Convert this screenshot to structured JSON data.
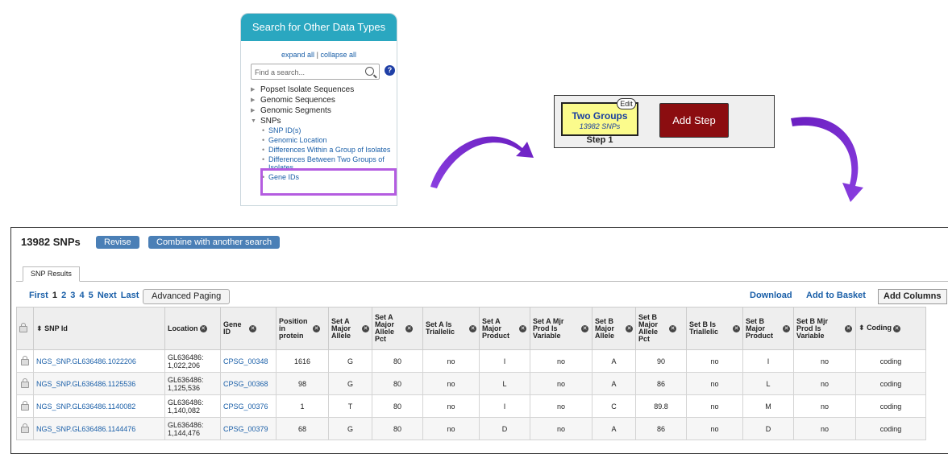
{
  "search_panel": {
    "title": "Search for Other Data Types",
    "expand_all": "expand all",
    "separator": "|",
    "collapse_all": "collapse all",
    "search_placeholder": "Find a search...",
    "tree": [
      {
        "label": "Popset Isolate Sequences"
      },
      {
        "label": "Genomic Sequences"
      },
      {
        "label": "Genomic Segments"
      },
      {
        "label": "SNPs"
      }
    ],
    "snp_children": [
      "SNP ID(s)",
      "Genomic Location",
      "Differences Within a Group of Isolates",
      "Differences Between Two Groups of Isolates",
      "Gene IDs"
    ]
  },
  "strategy": {
    "step_name": "Two Groups",
    "step_count": "13982 SNPs",
    "edit_label": "Edit",
    "step_label": "Step 1",
    "add_step_label": "Add Step"
  },
  "results": {
    "title": "13982 SNPs",
    "revise_label": "Revise",
    "combine_label": "Combine with another search",
    "tab_label": "SNP Results",
    "paging": {
      "first": "First",
      "pages": [
        "1",
        "2",
        "3",
        "4",
        "5"
      ],
      "next": "Next",
      "last": "Last"
    },
    "advanced_paging": "Advanced Paging",
    "download": "Download",
    "add_to_basket": "Add to Basket",
    "add_columns": "Add Columns",
    "headers": [
      "SNP Id",
      "Location",
      "Gene ID",
      "Position in protein",
      "Set A Major Allele",
      "Set A Major Allele Pct",
      "Set A Is Triallelic",
      "Set A Major Product",
      "Set A Mjr Prod Is Variable",
      "Set B Major Allele",
      "Set B Major Allele Pct",
      "Set B Is Triallelic",
      "Set B Major Product",
      "Set B Mjr Prod Is Variable",
      "Coding"
    ],
    "rows": [
      {
        "snp": "NGS_SNP.GL636486.1022206",
        "loc1": "GL636486:",
        "loc2": "1,022,206",
        "gene": "CPSG_00348",
        "pos": "1616",
        "a_allele": "G",
        "a_pct": "80",
        "a_tri": "no",
        "a_prod": "I",
        "a_var": "no",
        "b_allele": "A",
        "b_pct": "90",
        "b_tri": "no",
        "b_prod": "I",
        "b_var": "no",
        "coding": "coding"
      },
      {
        "snp": "NGS_SNP.GL636486.1125536",
        "loc1": "GL636486:",
        "loc2": "1,125,536",
        "gene": "CPSG_00368",
        "pos": "98",
        "a_allele": "G",
        "a_pct": "80",
        "a_tri": "no",
        "a_prod": "L",
        "a_var": "no",
        "b_allele": "A",
        "b_pct": "86",
        "b_tri": "no",
        "b_prod": "L",
        "b_var": "no",
        "coding": "coding"
      },
      {
        "snp": "NGS_SNP.GL636486.1140082",
        "loc1": "GL636486:",
        "loc2": "1,140,082",
        "gene": "CPSG_00376",
        "pos": "1",
        "a_allele": "T",
        "a_pct": "80",
        "a_tri": "no",
        "a_prod": "I",
        "a_var": "no",
        "b_allele": "C",
        "b_pct": "89.8",
        "b_tri": "no",
        "b_prod": "M",
        "b_var": "no",
        "coding": "coding"
      },
      {
        "snp": "NGS_SNP.GL636486.1144476",
        "loc1": "GL636486:",
        "loc2": "1,144,476",
        "gene": "CPSG_00379",
        "pos": "68",
        "a_allele": "G",
        "a_pct": "80",
        "a_tri": "no",
        "a_prod": "D",
        "a_var": "no",
        "b_allele": "A",
        "b_pct": "86",
        "b_tri": "no",
        "b_prod": "D",
        "b_var": "no",
        "coding": "coding"
      }
    ]
  },
  "colors": {
    "accent": "#2aa7c0",
    "highlight": "#b45ce0",
    "add_step": "#8b0d10",
    "step_box": "#fbfb8c",
    "link": "#1a5fa8"
  }
}
